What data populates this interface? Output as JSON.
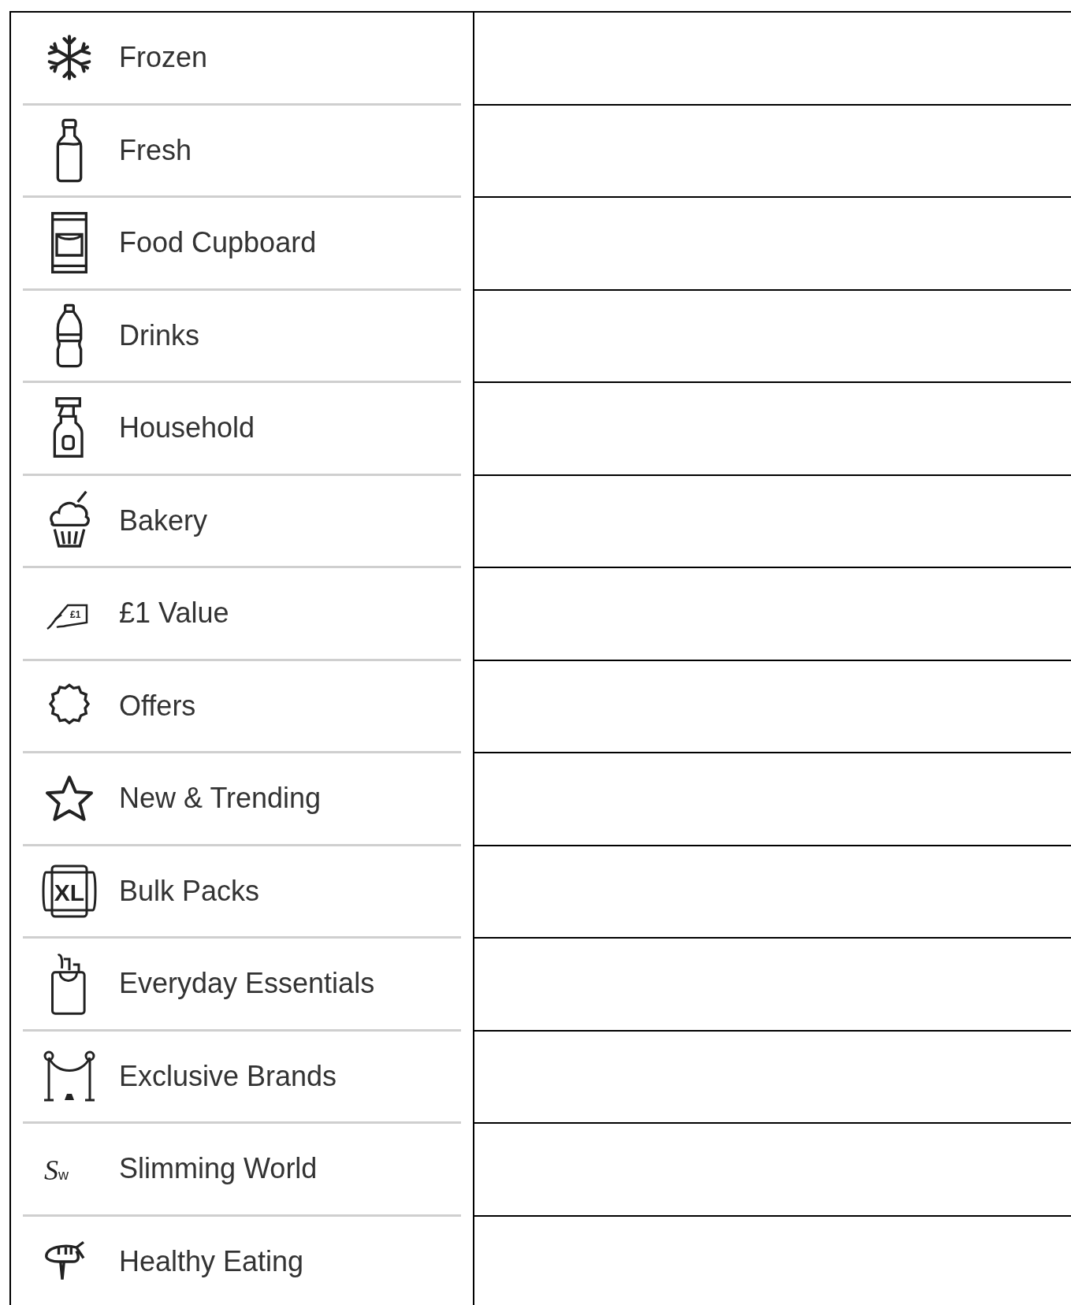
{
  "categories": [
    {
      "label": "Frozen",
      "kind": "snowflake"
    },
    {
      "label": "Fresh",
      "kind": "milk"
    },
    {
      "label": "Food Cupboard",
      "kind": "packet"
    },
    {
      "label": "Drinks",
      "kind": "bottle"
    },
    {
      "label": "Household",
      "kind": "spray"
    },
    {
      "label": "Bakery",
      "kind": "cupcake"
    },
    {
      "label": "£1 Value",
      "kind": "tag",
      "icon_text": "£1"
    },
    {
      "label": "Offers",
      "kind": "burst"
    },
    {
      "label": "New & Trending",
      "kind": "star"
    },
    {
      "label": "Bulk Packs",
      "kind": "xl",
      "icon_text": "XL"
    },
    {
      "label": "Everyday Essentials",
      "kind": "bag"
    },
    {
      "label": "Exclusive Brands",
      "kind": "rope"
    },
    {
      "label": "Slimming World",
      "kind": "sw",
      "icon_text": "Sw"
    },
    {
      "label": "Healthy Eating",
      "kind": "carrot"
    }
  ]
}
